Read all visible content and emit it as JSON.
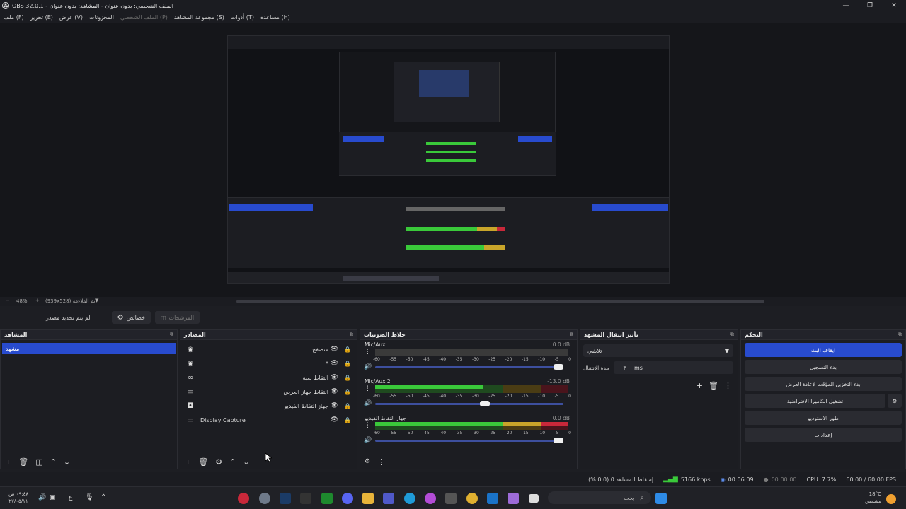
{
  "window": {
    "title": "OBS 32.0.1 - الملف الشخصي: بدون عنوان - المشاهد: بدون عنوان",
    "controls": [
      "—",
      "❐",
      "✕"
    ]
  },
  "menu": [
    {
      "label": "ملف (F)",
      "enabled": true
    },
    {
      "label": "تحرير (E)",
      "enabled": true
    },
    {
      "label": "عرض (V)",
      "enabled": true
    },
    {
      "label": "المحزونات",
      "enabled": true
    },
    {
      "label": "الملف الشخصي (P)",
      "enabled": false
    },
    {
      "label": "مجموعة المشاهد (S)",
      "enabled": true
    },
    {
      "label": "أدوات (T)",
      "enabled": true
    },
    {
      "label": "مساعدة (H)",
      "enabled": true
    }
  ],
  "zoom": {
    "value": "48%",
    "minus": "−",
    "plus": "+",
    "fit_label": "(939x528) تم الملاءمة"
  },
  "source_toolbar": {
    "no_source": "لم يتم تحديد مصدر",
    "properties": "خصائص",
    "filters": "المرشحات"
  },
  "scenes": {
    "title": "المشاهد",
    "items": [
      "مشهد"
    ]
  },
  "sources": {
    "title": "المصادر",
    "items": [
      {
        "name": "متصفح",
        "icon": "browser-icon"
      },
      {
        "name": "*",
        "icon": "browser-icon"
      },
      {
        "name": "التقاط لعبة",
        "icon": "gamepad-icon"
      },
      {
        "name": "التقاط جهاز العرض",
        "icon": "monitor-icon"
      },
      {
        "name": "جهاز التقاط الفيديو",
        "icon": "camera-icon"
      },
      {
        "name": "Display Capture",
        "icon": "monitor-icon"
      }
    ]
  },
  "mixer": {
    "title": "خلاط الصوتيات",
    "ticks": [
      "-60",
      "-55",
      "-50",
      "-45",
      "-40",
      "-35",
      "-30",
      "-25",
      "-20",
      "-15",
      "-10",
      "-5",
      "0"
    ],
    "channels": [
      {
        "name": "Mic/Aux",
        "db": "0.0 dB",
        "level": 0,
        "volume": 1.0,
        "muted": true
      },
      {
        "name": "Mic/Aux 2",
        "db": "-13.0 dB",
        "level": 0.56,
        "volume": 0.61,
        "muted": false
      },
      {
        "name": "جهاز التقاط الفيديو",
        "db": "0.0 dB",
        "level": 1.0,
        "volume": 1.0,
        "muted": false
      }
    ]
  },
  "transitions": {
    "title": "تأثير انتقال المشهد",
    "selected": "تلاشي",
    "duration_label": "مدة الانتقال",
    "duration": "٣٠٠ ms"
  },
  "controls": {
    "title": "التحكم",
    "buttons": [
      "ايقاف البث",
      "بدء التسجيل",
      "بدء التخزين المؤقت لإعادة العرض",
      "تشغيل الكاميرا الافتراضية",
      "طور الاستوديو",
      "إعدادات"
    ]
  },
  "status": {
    "dropped": "إسقاط المشاهد 0 (0.0 %)",
    "bitrate": "5166 kbps",
    "stream_time": "00:06:09",
    "rec_time": "00:00:00",
    "cpu": "CPU: 7.7%",
    "fps": "60.00 / 60.00 FPS"
  },
  "taskbar": {
    "search": "بحث",
    "time": "٠٩:٤٨ ص",
    "date": "٢٧/٠٥/١١",
    "lang": "ع",
    "weather_temp": "18°C",
    "weather_desc": "مشمس"
  },
  "colors": {
    "accent": "#284bce",
    "meter_green": "#3ac93a",
    "meter_yellow": "#c9a52a",
    "meter_red": "#c9283a"
  }
}
